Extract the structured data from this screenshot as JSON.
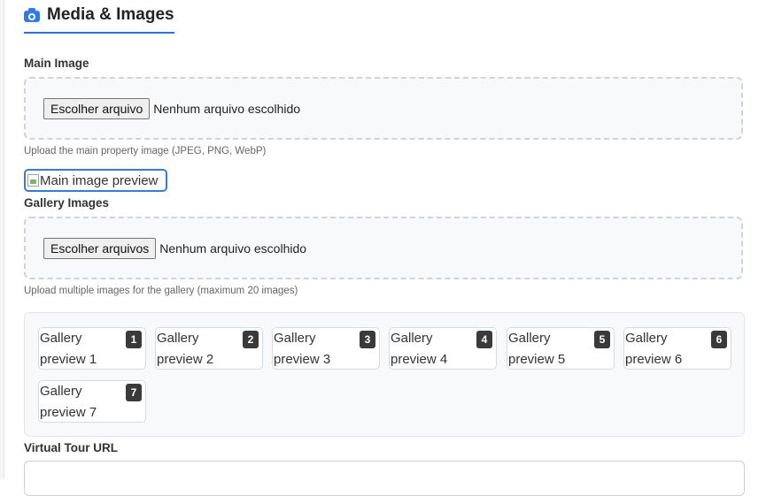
{
  "section": {
    "title": "Media & Images",
    "icon": "camera-icon"
  },
  "main_image": {
    "label": "Main Image",
    "button": "Escolher arquivo",
    "status": "Nenhum arquivo escolhido",
    "help": "Upload the main property image (JPEG, PNG, WebP)",
    "preview_alt": "Main image preview"
  },
  "gallery_images": {
    "label": "Gallery Images",
    "button": "Escolher arquivos",
    "status": "Nenhum arquivo escolhido",
    "help": "Upload multiple images for the gallery (maximum 20 images)",
    "items": [
      {
        "alt": "Gallery\npreview 1",
        "badge": "1"
      },
      {
        "alt": "Gallery\npreview 2",
        "badge": "2"
      },
      {
        "alt": "Gallery\npreview 3",
        "badge": "3"
      },
      {
        "alt": "Gallery\npreview 4",
        "badge": "4"
      },
      {
        "alt": "Gallery\npreview 5",
        "badge": "5"
      },
      {
        "alt": "Gallery\npreview 6",
        "badge": "6"
      },
      {
        "alt": "Gallery\npreview 7",
        "badge": "7"
      }
    ]
  },
  "virtual_tour": {
    "label": "Virtual Tour URL",
    "value": ""
  },
  "colors": {
    "accent": "#2f6fe0",
    "badge": "#3a3a3a"
  }
}
